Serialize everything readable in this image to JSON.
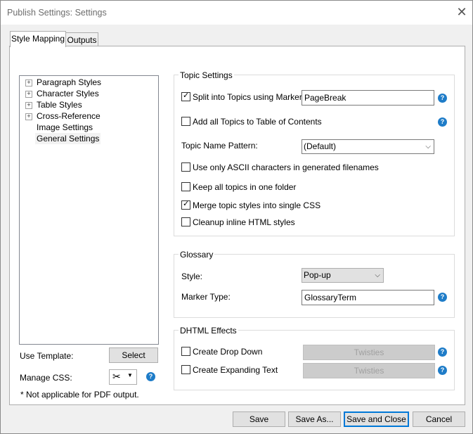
{
  "window": {
    "title": "Publish Settings: Settings"
  },
  "tabs": [
    {
      "label": "Style Mapping"
    },
    {
      "label": "Outputs"
    }
  ],
  "tree": {
    "items": [
      {
        "label": "Paragraph Styles",
        "expander": "+"
      },
      {
        "label": "Character Styles",
        "expander": "+"
      },
      {
        "label": "Table Styles",
        "expander": "+"
      },
      {
        "label": "Cross-Reference",
        "expander": "+"
      },
      {
        "label": "Image Settings",
        "expander": ""
      },
      {
        "label": "General Settings",
        "expander": ""
      }
    ]
  },
  "left": {
    "use_template_label": "Use Template:",
    "select_button": "Select",
    "manage_css_label": "Manage CSS:",
    "footnote": "* Not applicable for PDF output."
  },
  "topic_settings": {
    "title": "Topic Settings",
    "split_label": "Split into Topics using Marker:",
    "split_checked": true,
    "marker_value": "PageBreak",
    "add_toc_label": "Add all Topics to Table of Contents",
    "add_toc_checked": false,
    "name_pattern_label": "Topic Name Pattern:",
    "name_pattern_value": "(Default)",
    "ascii_label": "Use only ASCII characters in generated filenames",
    "ascii_checked": false,
    "one_folder_label": "Keep all topics in one folder",
    "one_folder_checked": false,
    "merge_label": "Merge topic styles into single CSS",
    "merge_checked": true,
    "cleanup_label": "Cleanup inline HTML styles",
    "cleanup_checked": false
  },
  "glossary": {
    "title": "Glossary",
    "style_label": "Style:",
    "style_value": "Pop-up",
    "marker_type_label": "Marker Type:",
    "marker_type_value": "GlossaryTerm"
  },
  "dhtml": {
    "title": "DHTML Effects",
    "drop_down_label": "Create Drop Down",
    "drop_down_checked": false,
    "drop_down_button": "Twisties",
    "expanding_label": "Create Expanding Text",
    "expanding_checked": false,
    "expanding_button": "Twisties"
  },
  "footer": {
    "save": "Save",
    "save_as": "Save As...",
    "save_close": "Save and Close",
    "cancel": "Cancel"
  },
  "icons": {
    "help": "?",
    "close": "✕",
    "checkmark": "✓",
    "chevron": "⌵"
  },
  "colors": {
    "accent": "#0078d7",
    "help": "#1e7cc8"
  }
}
